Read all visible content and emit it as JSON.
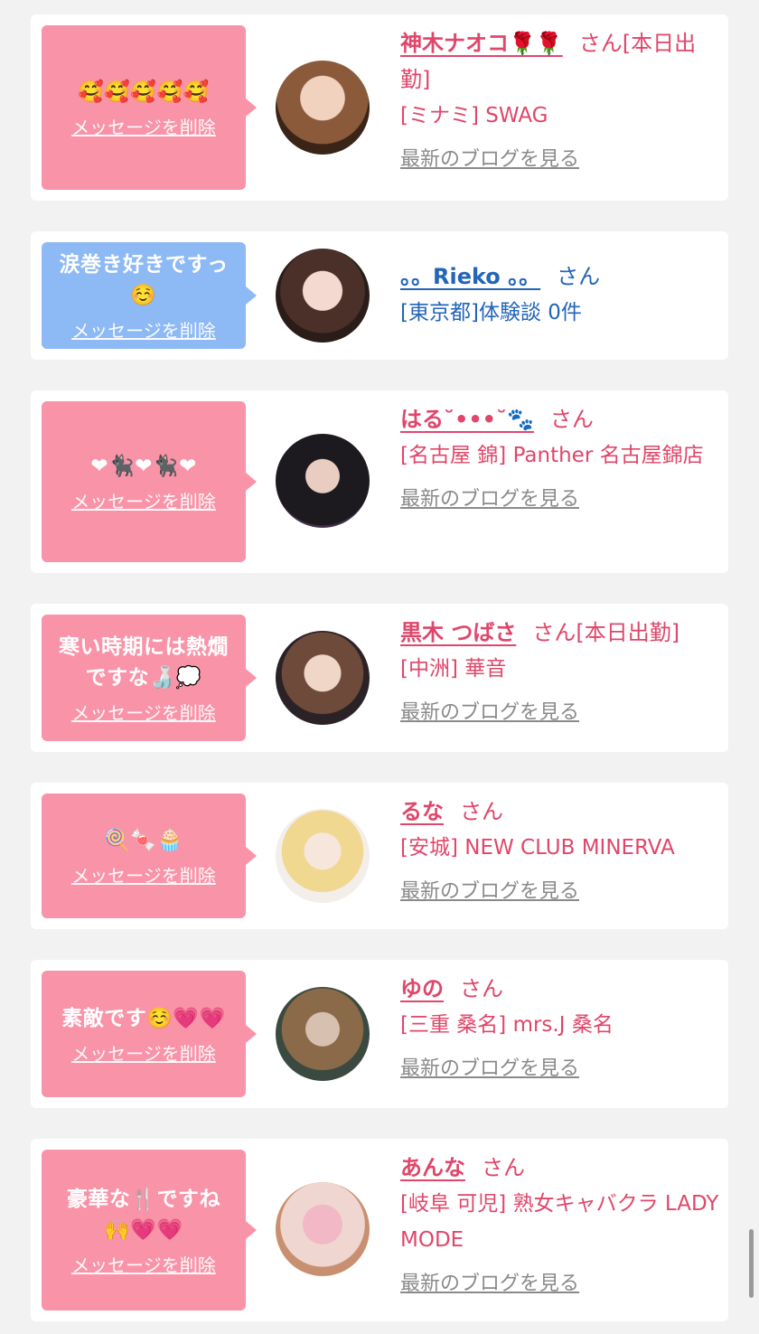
{
  "delete_label": "メッセージを削除",
  "blog_label": "最新のブログを見る",
  "san_label": "さん",
  "cards": [
    {
      "message": "🥰🥰🥰🥰🥰",
      "name": "神木ナオコ🌹🌹",
      "suffix": "さん[本日出勤]",
      "shop": "[ミナミ] SWAG",
      "blog": true,
      "bubble_color": "#f993a8"
    },
    {
      "message": "涙巻き好きですっ\n☺️",
      "name": "。。Rieko 。。",
      "suffix": "さん",
      "shop": "[東京都]体験談 0件",
      "blog": false,
      "bubble_color": "#8db9f5"
    },
    {
      "message": "❤🐈‍⬛❤🐈‍⬛❤",
      "name": "はる˘•••˘🐾",
      "suffix": "さん",
      "shop": "[名古屋 錦] Panther 名古屋錦店",
      "blog": true,
      "bubble_color": "#f993a8"
    },
    {
      "message": "寒い時期には熱燗\nですな🍶💭",
      "name": "黒木 つばさ",
      "suffix": "さん[本日出勤]",
      "shop": "[中洲] 華音",
      "blog": true,
      "bubble_color": "#f993a8"
    },
    {
      "message": "🍭🍬🧁",
      "name": "るな",
      "suffix": "さん",
      "shop": "[安城] NEW CLUB MINERVA",
      "blog": true,
      "bubble_color": "#f993a8"
    },
    {
      "message": "素敵です☺️💗💗",
      "name": "ゆの",
      "suffix": "さん",
      "shop": "[三重 桑名] mrs.J 桑名",
      "blog": true,
      "bubble_color": "#f993a8"
    },
    {
      "message": "豪華な🍴ですね\n🙌💗💗",
      "name": "あんな",
      "suffix": "さん",
      "shop": "[岐阜 可児] 熟女キャバクラ LADY MODE",
      "blog": true,
      "bubble_color": "#f993a8"
    }
  ]
}
